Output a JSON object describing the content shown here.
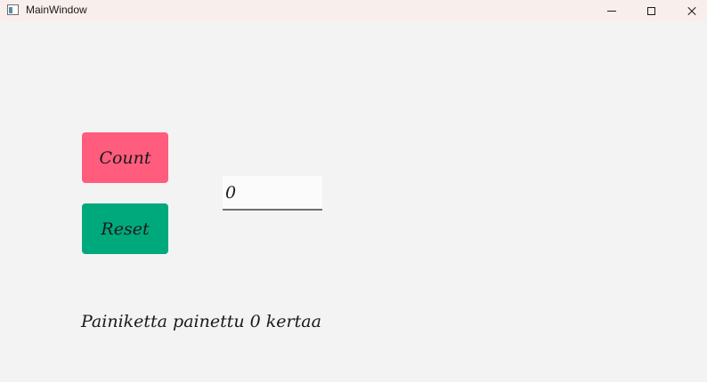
{
  "window": {
    "title": "MainWindow",
    "icon": "app-window-icon",
    "controls": {
      "minimize_icon": "minimize-icon",
      "maximize_icon": "maximize-icon",
      "close_icon": "close-icon"
    }
  },
  "main": {
    "count_button": {
      "label": "Count",
      "color": "#ff5c7e"
    },
    "reset_button": {
      "label": "Reset",
      "color": "#00a97c"
    },
    "count_field": {
      "value": "0"
    },
    "status_text": "Painiketta painettu 0 kertaa"
  }
}
